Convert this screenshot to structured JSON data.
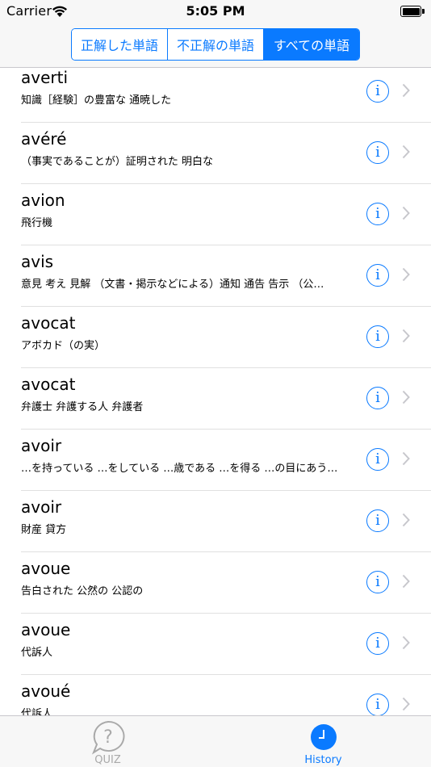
{
  "status_bar": {
    "carrier": "Carrier",
    "time": "5:05 PM",
    "wifi_icon": "wifi-icon",
    "battery_icon": "battery-icon",
    "battery_level": 1.0
  },
  "segmented_control": {
    "segments": [
      {
        "label": "正解した単語",
        "selected": false
      },
      {
        "label": "不正解の単語",
        "selected": false
      },
      {
        "label": "すべての単語",
        "selected": true
      }
    ],
    "accent_color": "#0a7aff"
  },
  "words": [
    {
      "word": "averti",
      "meaning": "知識［経験］の豊富な 通暁した"
    },
    {
      "word": "avéré",
      "meaning": "（事実であることが）証明された 明白な"
    },
    {
      "word": "avion",
      "meaning": "飛行機"
    },
    {
      "word": "avis",
      "meaning": "意見 考え 見解 （文書・掲示などによる）通知 通告 告示 （公…"
    },
    {
      "word": "avocat",
      "meaning": "アボカド（の実）"
    },
    {
      "word": "avocat",
      "meaning": "弁護士 弁護する人 弁護者"
    },
    {
      "word": "avoir",
      "meaning": "…を持っている …をしている …歳である …を得る …の目にあう…"
    },
    {
      "word": "avoir",
      "meaning": "財産 貸方"
    },
    {
      "word": "avoue",
      "meaning": "告白された 公然の 公認の"
    },
    {
      "word": "avoue",
      "meaning": "代訴人"
    },
    {
      "word": "avoué",
      "meaning": "代訴人"
    }
  ],
  "row_icons": {
    "info": "info-icon",
    "chevron": "chevron-right-icon"
  },
  "info_glyph": "i",
  "tab_bar": {
    "tabs": [
      {
        "label": "QUIZ",
        "icon": "question-bubble-icon",
        "selected": false
      },
      {
        "label": "History",
        "icon": "clock-icon",
        "selected": true
      }
    ]
  }
}
